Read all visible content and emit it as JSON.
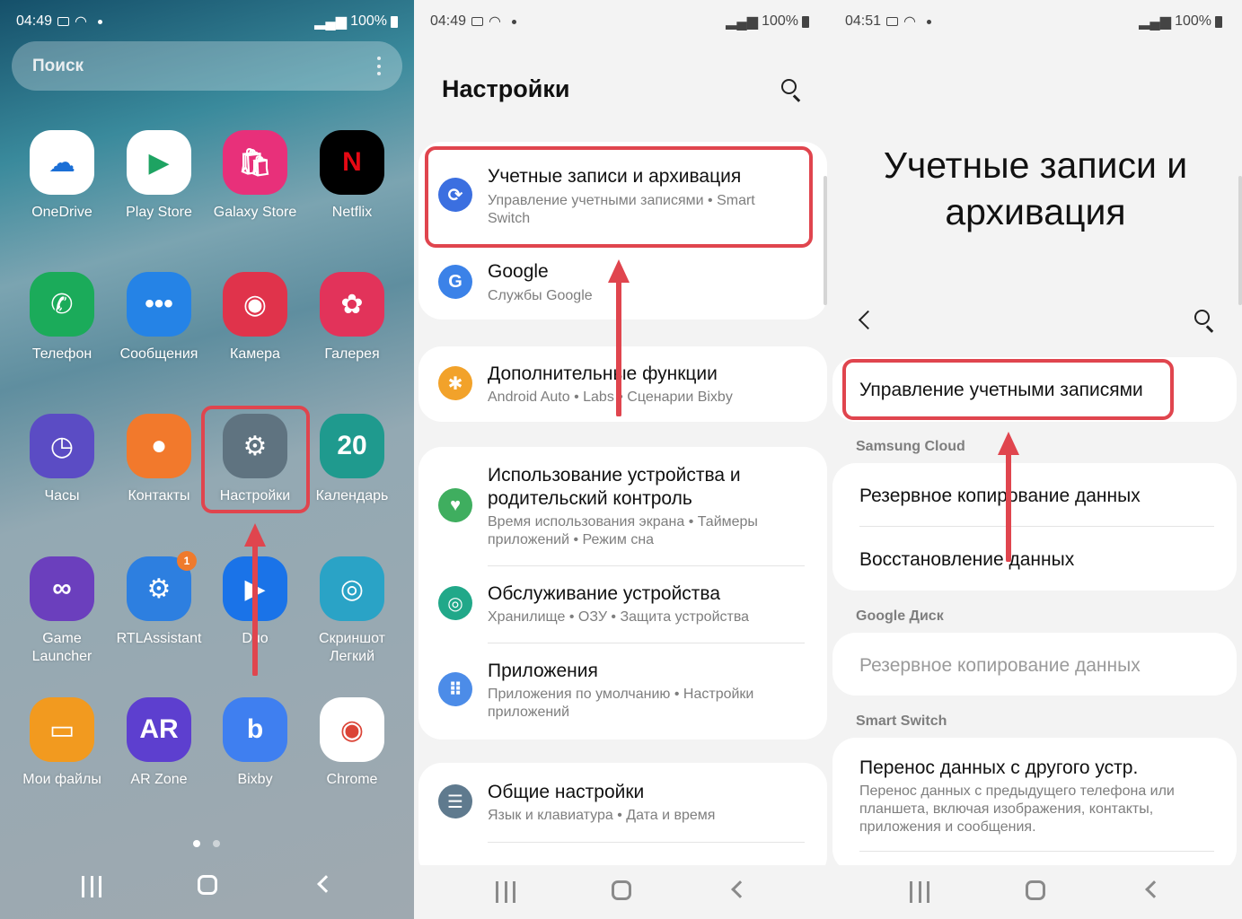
{
  "home": {
    "status": {
      "time": "04:49",
      "signal": "100%"
    },
    "search": {
      "placeholder": "Поиск"
    },
    "apps": [
      {
        "label": "OneDrive",
        "icon": "onedrive-icon",
        "color": "#ffffff"
      },
      {
        "label": "Play Store",
        "icon": "play-store-icon",
        "color": "#ffffff"
      },
      {
        "label": "Galaxy Store",
        "icon": "galaxy-store-icon",
        "color": "#e8307a"
      },
      {
        "label": "Netflix",
        "icon": "netflix-icon",
        "color": "#000000"
      },
      {
        "label": "Телефон",
        "icon": "phone-icon",
        "color": "#1bab5a"
      },
      {
        "label": "Сообщения",
        "icon": "messages-icon",
        "color": "#2583e6"
      },
      {
        "label": "Камера",
        "icon": "camera-icon",
        "color": "#e0334b"
      },
      {
        "label": "Галерея",
        "icon": "gallery-icon",
        "color": "#e2335a"
      },
      {
        "label": "Часы",
        "icon": "clock-icon",
        "color": "#5b4cc4"
      },
      {
        "label": "Контакты",
        "icon": "contacts-icon",
        "color": "#f2792c"
      },
      {
        "label": "Настройки",
        "icon": "settings-gear-icon",
        "color": "#5f7380"
      },
      {
        "label": "Календарь",
        "icon": "calendar-icon",
        "color": "#1f9a8e",
        "glyph": "20"
      },
      {
        "label": "Game Launcher",
        "icon": "game-launcher-icon",
        "color": "#6b3fbd"
      },
      {
        "label": "RTLAssistant",
        "icon": "rtlassistant-icon",
        "color": "#2d7fe0",
        "badge": "1"
      },
      {
        "label": "Duo",
        "icon": "duo-icon",
        "color": "#1a73e8"
      },
      {
        "label": "Скриншот Легкий",
        "icon": "screenshot-icon",
        "color": "#2aa3c6"
      },
      {
        "label": "Мои файлы",
        "icon": "my-files-icon",
        "color": "#f29a1f"
      },
      {
        "label": "AR Zone",
        "icon": "ar-zone-icon",
        "color": "#5d3fcf",
        "glyph": "AR"
      },
      {
        "label": "Bixby",
        "icon": "bixby-icon",
        "color": "#3f7ff0"
      },
      {
        "label": "Chrome",
        "icon": "chrome-icon",
        "color": "#ffffff"
      }
    ]
  },
  "settings": {
    "status": {
      "time": "04:49",
      "signal": "100%"
    },
    "title": "Настройки",
    "items": [
      {
        "title": "Учетные записи и архивация",
        "sub": "Управление учетными записями  •  Smart Switch",
        "icon": "sync-icon",
        "color": "#3b6fe0"
      },
      {
        "title": "Google",
        "sub": "Службы Google",
        "icon": "google-icon",
        "color": "#3b82e8",
        "glyph": "G"
      },
      {
        "title": "Дополнительные функции",
        "sub": "Android Auto  •  Labs  •  Сценарии Bixby",
        "icon": "advanced-features-icon",
        "color": "#f2a22a"
      },
      {
        "title": "Использование устройства и родительский контроль",
        "sub": "Время использования экрана  •  Таймеры приложений  •  Режим сна",
        "icon": "wellbeing-icon",
        "color": "#3fae5f"
      },
      {
        "title": "Обслуживание устройства",
        "sub": "Хранилище  •  ОЗУ  •  Защита устройства",
        "icon": "device-care-icon",
        "color": "#21a889"
      },
      {
        "title": "Приложения",
        "sub": "Приложения по умолчанию  •  Настройки приложений",
        "icon": "apps-icon",
        "color": "#4c8ce8"
      },
      {
        "title": "Общие настройки",
        "sub": "Язык и клавиатура  •  Дата и время",
        "icon": "general-settings-icon",
        "color": "#5f7a8e"
      }
    ]
  },
  "accounts": {
    "status": {
      "time": "04:51",
      "signal": "100%"
    },
    "title": "Учетные записи и архивация",
    "manage": "Управление учетными записями",
    "samsung_cloud": {
      "header": "Samsung Cloud",
      "backup": "Резервное копирование данных",
      "restore": "Восстановление данных"
    },
    "google_drive": {
      "header": "Google Диск",
      "backup": "Резервное копирование данных"
    },
    "smart_switch": {
      "header": "Smart Switch",
      "title": "Перенос данных с другого устр.",
      "sub": "Перенос данных с предыдущего телефона или планшета, включая изображения, контакты, приложения и сообщения."
    }
  },
  "colors": {
    "highlight": "#e0454e"
  }
}
